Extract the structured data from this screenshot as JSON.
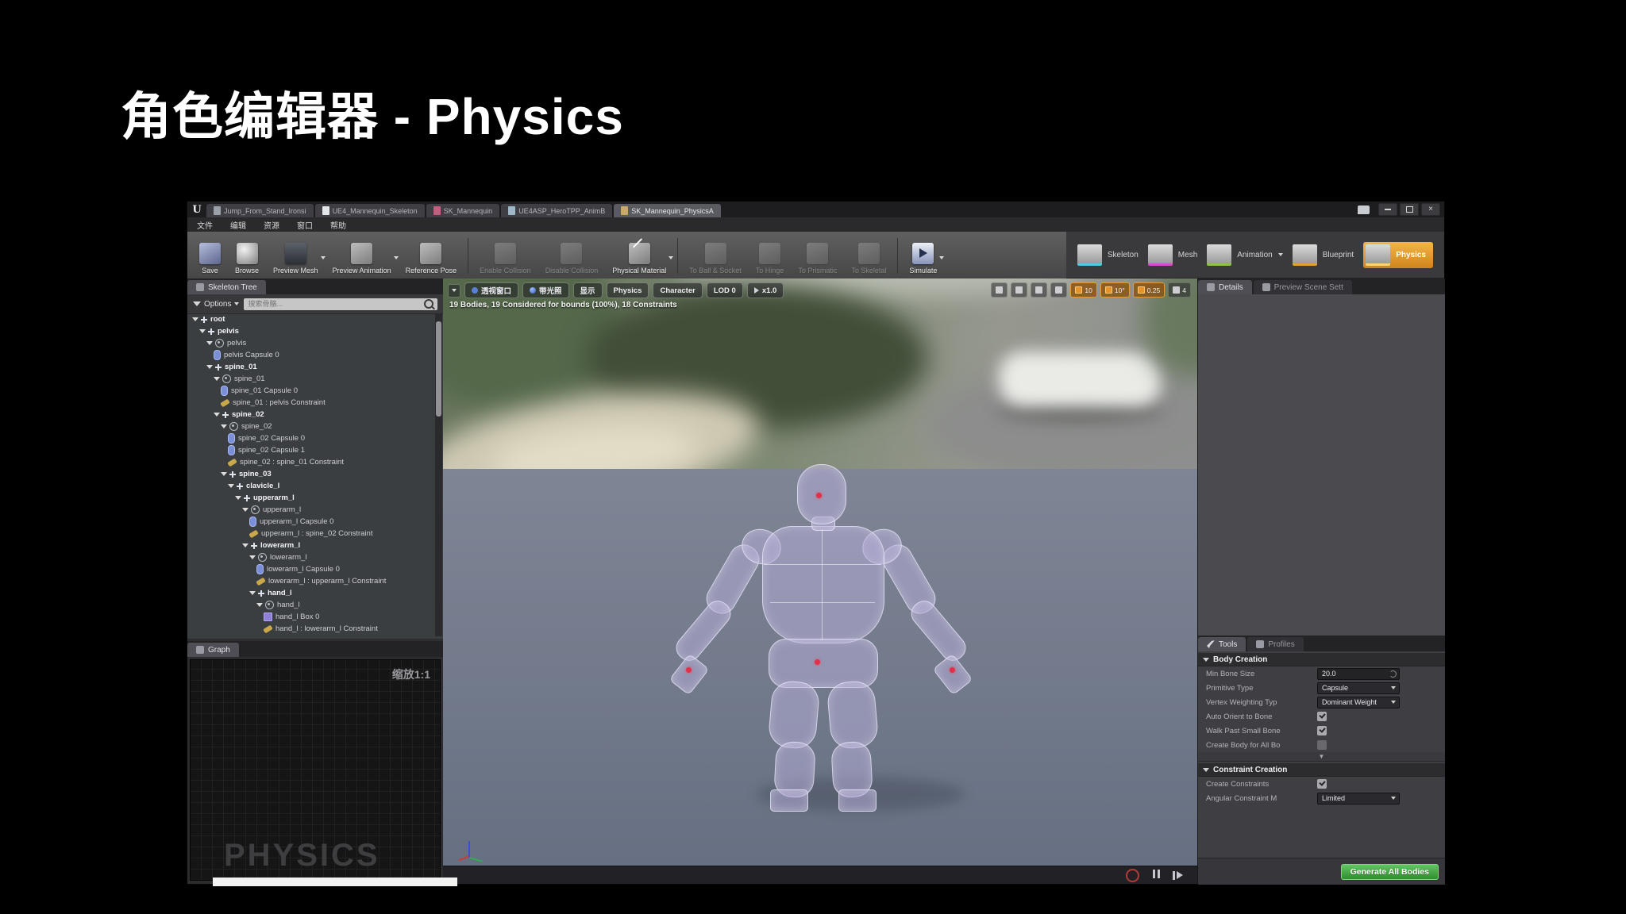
{
  "slide": {
    "title": "角色编辑器 - Physics"
  },
  "window": {
    "logo": "U",
    "tabs": [
      {
        "label": "Jump_From_Stand_Ironsi",
        "icon": "animation-asset-icon",
        "cls": "ic-anim",
        "active": false
      },
      {
        "label": "UE4_Mannequin_Skeleton",
        "icon": "skeleton-asset-icon",
        "cls": "ic-skel",
        "active": false
      },
      {
        "label": "SK_Mannequin",
        "icon": "mesh-asset-icon",
        "cls": "ic-meshpink",
        "active": false
      },
      {
        "label": "UE4ASP_HeroTPP_AnimB",
        "icon": "blueprint-asset-icon",
        "cls": "ic-doc",
        "active": false
      },
      {
        "label": "SK_Mannequin_PhysicsA",
        "icon": "physics-asset-icon",
        "cls": "ic-physdoc",
        "active": true
      }
    ],
    "menu": [
      "文件",
      "编辑",
      "资源",
      "窗口",
      "帮助"
    ]
  },
  "toolbar": {
    "buttons": [
      {
        "label": "Save",
        "icon": "save-icon",
        "cls": "ti-save",
        "enabled": true,
        "group": 0
      },
      {
        "label": "Browse",
        "icon": "browse-icon",
        "cls": "ti-browse",
        "enabled": true,
        "group": 0
      },
      {
        "label": "Preview Mesh",
        "icon": "preview-mesh-icon",
        "cls": "ti-preview-mesh",
        "enabled": true,
        "dropdown": true,
        "group": 0
      },
      {
        "label": "Preview Animation",
        "icon": "preview-animation-icon",
        "cls": "",
        "enabled": true,
        "dropdown": true,
        "group": 0
      },
      {
        "label": "Reference Pose",
        "icon": "reference-pose-icon",
        "cls": "",
        "enabled": true,
        "group": 0
      },
      {
        "label": "Enable Collision",
        "icon": "enable-collision-icon",
        "cls": "",
        "enabled": false,
        "group": 1
      },
      {
        "label": "Disable Collision",
        "icon": "disable-collision-icon",
        "cls": "",
        "enabled": false,
        "group": 1
      },
      {
        "label": "Physical Material",
        "icon": "physical-material-icon",
        "cls": "ti-physical-material",
        "enabled": true,
        "dropdown": true,
        "group": 1
      },
      {
        "label": "To Ball & Socket",
        "icon": "to-ball-socket-icon",
        "cls": "",
        "enabled": false,
        "group": 2
      },
      {
        "label": "To Hinge",
        "icon": "to-hinge-icon",
        "cls": "",
        "enabled": false,
        "group": 2
      },
      {
        "label": "To Prismatic",
        "icon": "to-prismatic-icon",
        "cls": "",
        "enabled": false,
        "group": 2
      },
      {
        "label": "To Skeletal",
        "icon": "to-skeletal-icon",
        "cls": "",
        "enabled": false,
        "group": 2
      },
      {
        "label": "Simulate",
        "icon": "simulate-icon",
        "cls": "ti-simulate",
        "enabled": true,
        "dropdown": true,
        "group": 3
      }
    ],
    "asset_shortcuts": [
      {
        "label": "Skeleton",
        "underline": "#4ec9e0",
        "active": false
      },
      {
        "label": "Mesh",
        "underline": "#d24dd2",
        "active": false
      },
      {
        "label": "Animation",
        "underline": "#8bc34a",
        "active": false,
        "dropdown": true
      },
      {
        "label": "Blueprint",
        "underline": "#e0a030",
        "active": false
      },
      {
        "label": "Physics",
        "underline": "#ffd27a",
        "active": true
      }
    ]
  },
  "skeleton_tree": {
    "tab": "Skeleton Tree",
    "options_label": "Options",
    "search_placeholder": "搜索骨骼...",
    "items": [
      {
        "d": 0,
        "icon": "bone",
        "label": "root",
        "bold": true
      },
      {
        "d": 1,
        "icon": "bone",
        "label": "pelvis",
        "bold": true
      },
      {
        "d": 2,
        "icon": "body",
        "label": "pelvis",
        "bold": false
      },
      {
        "d": 3,
        "icon": "capsule",
        "label": "pelvis Capsule 0",
        "bold": false
      },
      {
        "d": 2,
        "icon": "bone",
        "label": "spine_01",
        "bold": true
      },
      {
        "d": 3,
        "icon": "body",
        "label": "spine_01",
        "bold": false
      },
      {
        "d": 4,
        "icon": "capsule",
        "label": "spine_01 Capsule 0",
        "bold": false
      },
      {
        "d": 4,
        "icon": "constraint",
        "label": "spine_01 : pelvis Constraint",
        "bold": false
      },
      {
        "d": 3,
        "icon": "bone",
        "label": "spine_02",
        "bold": true
      },
      {
        "d": 4,
        "icon": "body",
        "label": "spine_02",
        "bold": false
      },
      {
        "d": 5,
        "icon": "capsule",
        "label": "spine_02 Capsule 0",
        "bold": false
      },
      {
        "d": 5,
        "icon": "capsule",
        "label": "spine_02 Capsule 1",
        "bold": false
      },
      {
        "d": 5,
        "icon": "constraint",
        "label": "spine_02 : spine_01 Constraint",
        "bold": false
      },
      {
        "d": 4,
        "icon": "bone",
        "label": "spine_03",
        "bold": true
      },
      {
        "d": 5,
        "icon": "bone",
        "label": "clavicle_l",
        "bold": true
      },
      {
        "d": 6,
        "icon": "bone",
        "label": "upperarm_l",
        "bold": true
      },
      {
        "d": 7,
        "icon": "body",
        "label": "upperarm_l",
        "bold": false
      },
      {
        "d": 8,
        "icon": "capsule",
        "label": "upperarm_l Capsule 0",
        "bold": false
      },
      {
        "d": 8,
        "icon": "constraint",
        "label": "upperarm_l : spine_02 Constraint",
        "bold": false
      },
      {
        "d": 7,
        "icon": "bone",
        "label": "lowerarm_l",
        "bold": true
      },
      {
        "d": 8,
        "icon": "body",
        "label": "lowerarm_l",
        "bold": false
      },
      {
        "d": 9,
        "icon": "capsule",
        "label": "lowerarm_l Capsule 0",
        "bold": false
      },
      {
        "d": 9,
        "icon": "constraint",
        "label": "lowerarm_l : upperarm_l Constraint",
        "bold": false
      },
      {
        "d": 8,
        "icon": "bone",
        "label": "hand_l",
        "bold": true
      },
      {
        "d": 9,
        "icon": "body",
        "label": "hand_l",
        "bold": false
      },
      {
        "d": 10,
        "icon": "box",
        "label": "hand_l Box 0",
        "bold": false
      },
      {
        "d": 10,
        "icon": "constraint",
        "label": "hand_l : lowerarm_l Constraint",
        "bold": false
      }
    ]
  },
  "graph": {
    "tab": "Graph",
    "zoom_label": "缩放1:1",
    "watermark": "PHYSICS"
  },
  "viewport": {
    "stats": "19 Bodies, 19 Considered for bounds (100%), 18 Constraints",
    "toolbar": [
      {
        "label": "透视窗口",
        "icon": "perspective-icon",
        "dot": "d-persp"
      },
      {
        "label": "带光照",
        "icon": "lit-mode-icon",
        "dot": "d-lit"
      },
      {
        "label": "显示",
        "icon": null,
        "dot": null
      },
      {
        "label": "Physics",
        "icon": null,
        "dot": null
      },
      {
        "label": "Character",
        "icon": null,
        "dot": null
      },
      {
        "label": "LOD 0",
        "icon": null,
        "dot": null
      },
      {
        "label": "x1.0",
        "icon": "speed-icon",
        "dot": "d-speed"
      }
    ],
    "snaps": [
      {
        "name": "move-tool-icon",
        "value": "",
        "orange": false
      },
      {
        "name": "rotate-tool-icon",
        "value": "",
        "orange": false
      },
      {
        "name": "scale-tool-icon",
        "value": "",
        "orange": false
      },
      {
        "name": "world-coordinate-icon",
        "value": "",
        "orange": false
      },
      {
        "name": "grid-snap-icon",
        "value": "10",
        "orange": true
      },
      {
        "name": "rotation-snap-icon",
        "value": "10°",
        "orange": true
      },
      {
        "name": "scale-snap-icon",
        "value": "0.25",
        "orange": true
      },
      {
        "name": "camera-speed-icon",
        "value": "4",
        "orange": false
      }
    ]
  },
  "details": {
    "tabs": [
      "Details",
      "Preview Scene Sett"
    ]
  },
  "tools": {
    "tabs": [
      "Tools",
      "Profiles"
    ],
    "sections": [
      {
        "title": "Body Creation",
        "rows": [
          {
            "label": "Min Bone Size",
            "control": "spin",
            "value": "20.0"
          },
          {
            "label": "Primitive Type",
            "control": "select",
            "value": "Capsule"
          },
          {
            "label": "Vertex Weighting Typ",
            "control": "select",
            "value": "Dominant Weight"
          },
          {
            "label": "Auto Orient to Bone",
            "control": "check",
            "checked": true
          },
          {
            "label": "Walk Past Small Bone",
            "control": "check",
            "checked": true
          },
          {
            "label": "Create Body for All Bo",
            "control": "check",
            "checked": false,
            "enabled": false
          }
        ]
      },
      {
        "title": "Constraint Creation",
        "rows": [
          {
            "label": "Create Constraints",
            "control": "check",
            "checked": true
          },
          {
            "label": "Angular Constraint M",
            "control": "select",
            "value": "Limited"
          }
        ]
      }
    ],
    "generate_button": "Generate All Bodies"
  }
}
